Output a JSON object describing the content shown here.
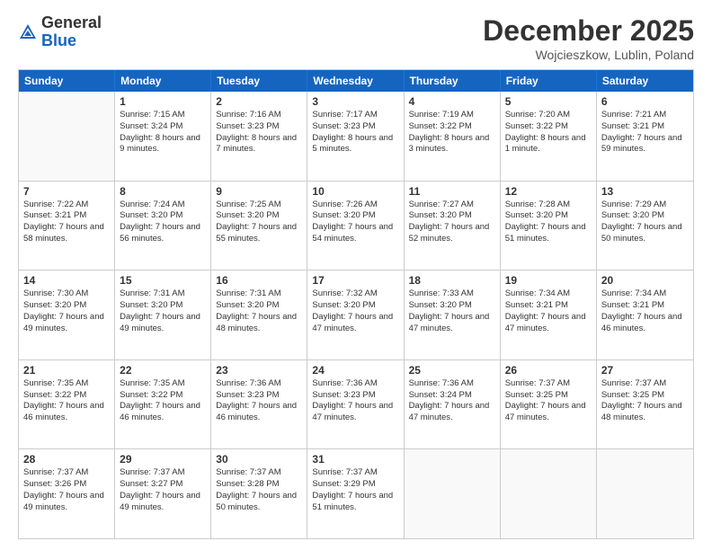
{
  "logo": {
    "general": "General",
    "blue": "Blue"
  },
  "header": {
    "month": "December 2025",
    "location": "Wojcieszkow, Lublin, Poland"
  },
  "days": [
    "Sunday",
    "Monday",
    "Tuesday",
    "Wednesday",
    "Thursday",
    "Friday",
    "Saturday"
  ],
  "weeks": [
    [
      {
        "num": "",
        "sunrise": "",
        "sunset": "",
        "daylight": "",
        "empty": true
      },
      {
        "num": "1",
        "sunrise": "Sunrise: 7:15 AM",
        "sunset": "Sunset: 3:24 PM",
        "daylight": "Daylight: 8 hours and 9 minutes."
      },
      {
        "num": "2",
        "sunrise": "Sunrise: 7:16 AM",
        "sunset": "Sunset: 3:23 PM",
        "daylight": "Daylight: 8 hours and 7 minutes."
      },
      {
        "num": "3",
        "sunrise": "Sunrise: 7:17 AM",
        "sunset": "Sunset: 3:23 PM",
        "daylight": "Daylight: 8 hours and 5 minutes."
      },
      {
        "num": "4",
        "sunrise": "Sunrise: 7:19 AM",
        "sunset": "Sunset: 3:22 PM",
        "daylight": "Daylight: 8 hours and 3 minutes."
      },
      {
        "num": "5",
        "sunrise": "Sunrise: 7:20 AM",
        "sunset": "Sunset: 3:22 PM",
        "daylight": "Daylight: 8 hours and 1 minute."
      },
      {
        "num": "6",
        "sunrise": "Sunrise: 7:21 AM",
        "sunset": "Sunset: 3:21 PM",
        "daylight": "Daylight: 7 hours and 59 minutes."
      }
    ],
    [
      {
        "num": "7",
        "sunrise": "Sunrise: 7:22 AM",
        "sunset": "Sunset: 3:21 PM",
        "daylight": "Daylight: 7 hours and 58 minutes."
      },
      {
        "num": "8",
        "sunrise": "Sunrise: 7:24 AM",
        "sunset": "Sunset: 3:20 PM",
        "daylight": "Daylight: 7 hours and 56 minutes."
      },
      {
        "num": "9",
        "sunrise": "Sunrise: 7:25 AM",
        "sunset": "Sunset: 3:20 PM",
        "daylight": "Daylight: 7 hours and 55 minutes."
      },
      {
        "num": "10",
        "sunrise": "Sunrise: 7:26 AM",
        "sunset": "Sunset: 3:20 PM",
        "daylight": "Daylight: 7 hours and 54 minutes."
      },
      {
        "num": "11",
        "sunrise": "Sunrise: 7:27 AM",
        "sunset": "Sunset: 3:20 PM",
        "daylight": "Daylight: 7 hours and 52 minutes."
      },
      {
        "num": "12",
        "sunrise": "Sunrise: 7:28 AM",
        "sunset": "Sunset: 3:20 PM",
        "daylight": "Daylight: 7 hours and 51 minutes."
      },
      {
        "num": "13",
        "sunrise": "Sunrise: 7:29 AM",
        "sunset": "Sunset: 3:20 PM",
        "daylight": "Daylight: 7 hours and 50 minutes."
      }
    ],
    [
      {
        "num": "14",
        "sunrise": "Sunrise: 7:30 AM",
        "sunset": "Sunset: 3:20 PM",
        "daylight": "Daylight: 7 hours and 49 minutes."
      },
      {
        "num": "15",
        "sunrise": "Sunrise: 7:31 AM",
        "sunset": "Sunset: 3:20 PM",
        "daylight": "Daylight: 7 hours and 49 minutes."
      },
      {
        "num": "16",
        "sunrise": "Sunrise: 7:31 AM",
        "sunset": "Sunset: 3:20 PM",
        "daylight": "Daylight: 7 hours and 48 minutes."
      },
      {
        "num": "17",
        "sunrise": "Sunrise: 7:32 AM",
        "sunset": "Sunset: 3:20 PM",
        "daylight": "Daylight: 7 hours and 47 minutes."
      },
      {
        "num": "18",
        "sunrise": "Sunrise: 7:33 AM",
        "sunset": "Sunset: 3:20 PM",
        "daylight": "Daylight: 7 hours and 47 minutes."
      },
      {
        "num": "19",
        "sunrise": "Sunrise: 7:34 AM",
        "sunset": "Sunset: 3:21 PM",
        "daylight": "Daylight: 7 hours and 47 minutes."
      },
      {
        "num": "20",
        "sunrise": "Sunrise: 7:34 AM",
        "sunset": "Sunset: 3:21 PM",
        "daylight": "Daylight: 7 hours and 46 minutes."
      }
    ],
    [
      {
        "num": "21",
        "sunrise": "Sunrise: 7:35 AM",
        "sunset": "Sunset: 3:22 PM",
        "daylight": "Daylight: 7 hours and 46 minutes."
      },
      {
        "num": "22",
        "sunrise": "Sunrise: 7:35 AM",
        "sunset": "Sunset: 3:22 PM",
        "daylight": "Daylight: 7 hours and 46 minutes."
      },
      {
        "num": "23",
        "sunrise": "Sunrise: 7:36 AM",
        "sunset": "Sunset: 3:23 PM",
        "daylight": "Daylight: 7 hours and 46 minutes."
      },
      {
        "num": "24",
        "sunrise": "Sunrise: 7:36 AM",
        "sunset": "Sunset: 3:23 PM",
        "daylight": "Daylight: 7 hours and 47 minutes."
      },
      {
        "num": "25",
        "sunrise": "Sunrise: 7:36 AM",
        "sunset": "Sunset: 3:24 PM",
        "daylight": "Daylight: 7 hours and 47 minutes."
      },
      {
        "num": "26",
        "sunrise": "Sunrise: 7:37 AM",
        "sunset": "Sunset: 3:25 PM",
        "daylight": "Daylight: 7 hours and 47 minutes."
      },
      {
        "num": "27",
        "sunrise": "Sunrise: 7:37 AM",
        "sunset": "Sunset: 3:25 PM",
        "daylight": "Daylight: 7 hours and 48 minutes."
      }
    ],
    [
      {
        "num": "28",
        "sunrise": "Sunrise: 7:37 AM",
        "sunset": "Sunset: 3:26 PM",
        "daylight": "Daylight: 7 hours and 49 minutes."
      },
      {
        "num": "29",
        "sunrise": "Sunrise: 7:37 AM",
        "sunset": "Sunset: 3:27 PM",
        "daylight": "Daylight: 7 hours and 49 minutes."
      },
      {
        "num": "30",
        "sunrise": "Sunrise: 7:37 AM",
        "sunset": "Sunset: 3:28 PM",
        "daylight": "Daylight: 7 hours and 50 minutes."
      },
      {
        "num": "31",
        "sunrise": "Sunrise: 7:37 AM",
        "sunset": "Sunset: 3:29 PM",
        "daylight": "Daylight: 7 hours and 51 minutes."
      },
      {
        "num": "",
        "sunrise": "",
        "sunset": "",
        "daylight": "",
        "empty": true
      },
      {
        "num": "",
        "sunrise": "",
        "sunset": "",
        "daylight": "",
        "empty": true
      },
      {
        "num": "",
        "sunrise": "",
        "sunset": "",
        "daylight": "",
        "empty": true
      }
    ]
  ]
}
